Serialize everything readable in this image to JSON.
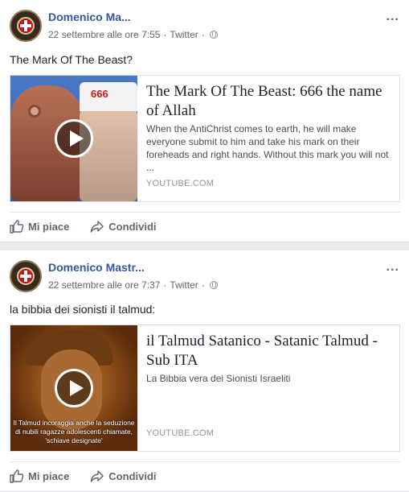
{
  "posts": [
    {
      "author": "Domenico Ma...",
      "date": "22 settembre alle ore 7:55",
      "source": "Twitter",
      "more": "...",
      "text": "The Mark Of The Beast?",
      "card": {
        "title": "The Mark Of The Beast: 666 the name of Allah",
        "description": "When the AntiChrist comes to earth, he will make everyone submit to him and take his mark on their foreheads and right hands. Without this mark you will not ...",
        "domain": "YOUTUBE.COM",
        "thumb_text": "666"
      },
      "actions": {
        "like": "Mi piace",
        "share": "Condividi"
      }
    },
    {
      "author": "Domenico Mastr...",
      "date": "22 settembre alle ore 7:37",
      "source": "Twitter",
      "more": "...",
      "text": "la bibbia dei sionisti il talmud:",
      "card": {
        "title": "il Talmud Satanico - Satanic Talmud - Sub ITA",
        "description": "La Bibbia vera dei Sionisti Israeliti",
        "domain": "YOUTUBE.COM",
        "thumb_text": "Il Talmud incoraggia anche la seduzione di nubili ragazze adolescenti chiamate, 'schiave designate'"
      },
      "actions": {
        "like": "Mi piace",
        "share": "Condividi"
      }
    }
  ],
  "colors": {
    "link": "#365899",
    "meta": "#616770",
    "background": "#e9ebee"
  }
}
